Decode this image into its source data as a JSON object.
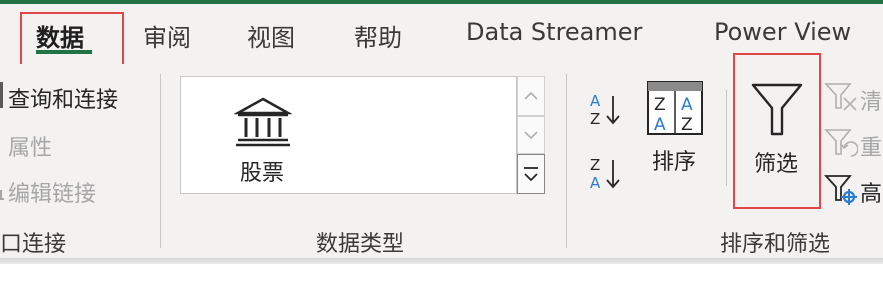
{
  "tabs": {
    "data": "数据",
    "review": "审阅",
    "view": "视图",
    "help": "帮助",
    "data_streamer": "Data Streamer",
    "power_view": "Power View"
  },
  "queries_group": {
    "queries_connections": "查询和连接",
    "properties": "属性",
    "edit_links": "编辑链接",
    "group_label": "口连接"
  },
  "data_types_group": {
    "stocks": "股票",
    "group_label": "数据类型"
  },
  "sort_filter_group": {
    "sort": "排序",
    "filter": "筛选",
    "clear": "清",
    "reapply": "重",
    "advanced": "高",
    "group_label": "排序和筛选"
  },
  "colors": {
    "accent": "#217346",
    "highlight": "#e04848",
    "icon_blue": "#2b7cd3"
  }
}
